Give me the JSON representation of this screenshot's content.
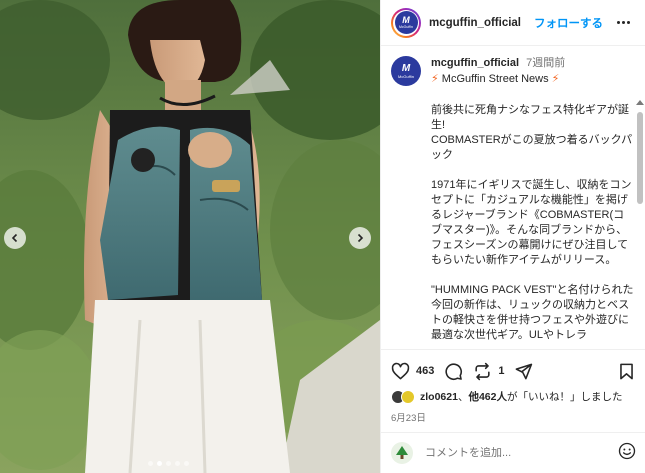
{
  "post": {
    "username": "mcguffin_official",
    "follow_label": "フォローする",
    "avatar_mark": "M",
    "avatar_sub": "McGuffin"
  },
  "caption": {
    "username": "mcguffin_official",
    "time": "7週間前",
    "bolt": "⚡",
    "tag_text": " McGuffin Street News ",
    "paragraphs": [
      "前後共に死角ナシなフェス特化ギアが誕生!\nCOBMASTERがこの夏放つ着るバックパック",
      "1971年にイギリスで誕生し、収納をコンセプトに「カジュアルな機能性」を掲げるレジャーブランド《COBMASTER(コブマスター)》。そんな同ブランドから、フェスシーズンの幕開けにぜひ注目してもらいたい新作アイテムがリリース。",
      "\"HUMMING PACK VEST\"と名付けられた今回の新作は、リュックの収納力とベストの軽快さを併せ持つフェスや外遊びに最適な次世代ギア。ULやトレラ"
    ]
  },
  "actions": {
    "like_count": "463",
    "share_count": "1"
  },
  "likes": {
    "user": "zlo0621",
    "others": "他462人",
    "suffix": "が「いいね！」しました"
  },
  "date": "6月23日",
  "comment": {
    "placeholder": "コメントを追加..."
  },
  "carousel": {
    "dot_count": 5,
    "active_index": 1
  },
  "colors": {
    "follow_blue": "#0095f6",
    "brand_navy": "#2b3a9e",
    "bolt_orange": "#f26522"
  }
}
